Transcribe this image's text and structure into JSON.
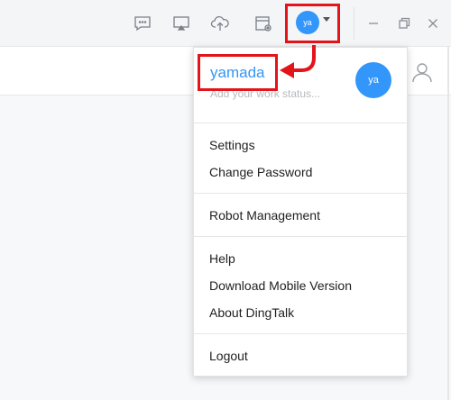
{
  "titlebar": {
    "icons": [
      "message-icon",
      "screen-share-icon",
      "cloud-upload-icon",
      "calendar-settings-icon"
    ],
    "avatar_initials": "ya",
    "window_buttons": [
      "minimize-icon",
      "restore-icon",
      "close-icon"
    ]
  },
  "profile": {
    "name": "yamada",
    "status_placeholder": "Add your work status...",
    "avatar_initials": "ya"
  },
  "menu": {
    "group1": [
      "Settings",
      "Change Password"
    ],
    "group2": [
      "Robot Management"
    ],
    "group3": [
      "Help",
      "Download Mobile Version",
      "About DingTalk"
    ],
    "group4": [
      "Logout"
    ]
  },
  "colors": {
    "accent": "#3296fa",
    "highlight": "#e3141a"
  }
}
